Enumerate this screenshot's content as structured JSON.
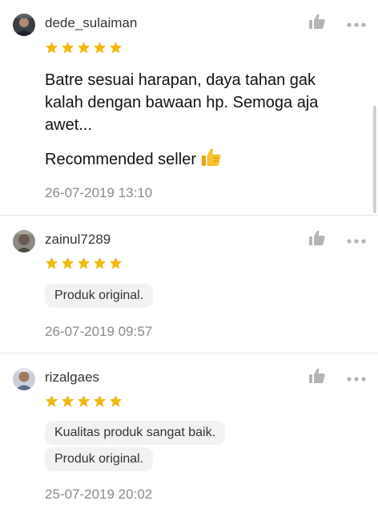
{
  "reviews": [
    {
      "username": "dede_sulaiman",
      "rating": 5,
      "text_lines": [
        "Batre sesuai harapan, daya tahan gak",
        "kalah dengan bawaan hp. Semoga aja",
        "awet..."
      ],
      "text_extra": "Recommended seller",
      "timestamp": "26-07-2019 13:10"
    },
    {
      "username": "zainul7289",
      "rating": 5,
      "tags": [
        "Produk original."
      ],
      "timestamp": "26-07-2019 09:57"
    },
    {
      "username": "rizalgaes",
      "rating": 5,
      "tags": [
        "Kualitas produk sangat baik.",
        "Produk original."
      ],
      "timestamp": "25-07-2019 20:02"
    }
  ],
  "icons": {
    "like": "thumbs-up-icon",
    "more": "more-options-icon",
    "star": "star-icon",
    "emoji": "thumbs-up-emoji"
  },
  "colors": {
    "star": "#F5B50A",
    "icon_gray": "#B5B5B5",
    "timestamp": "#8A8A8A",
    "tag_bg": "#F2F2F2"
  }
}
